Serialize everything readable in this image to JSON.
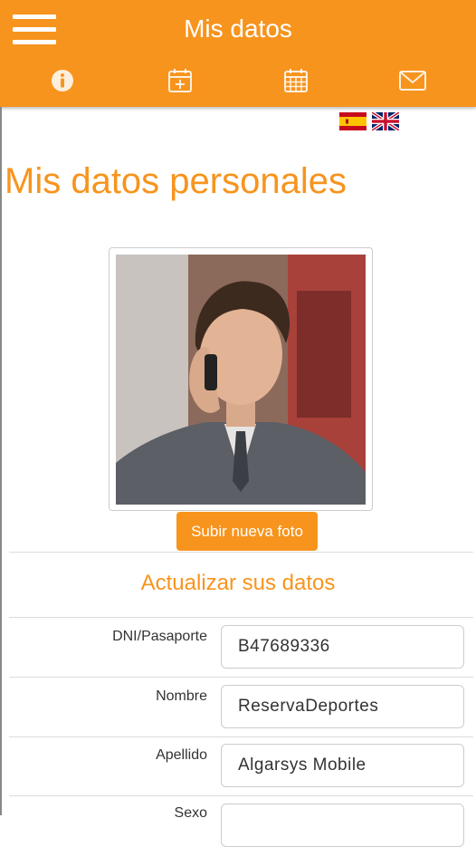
{
  "header": {
    "title": "Mis datos",
    "tabs": [
      {
        "icon": "info-icon"
      },
      {
        "icon": "calendar-add-icon"
      },
      {
        "icon": "calendar-icon"
      },
      {
        "icon": "mail-icon"
      }
    ],
    "color": "#f7941d"
  },
  "languages": [
    {
      "icon": "spain-flag-icon"
    },
    {
      "icon": "uk-flag-icon"
    }
  ],
  "page": {
    "title": "Mis datos personales",
    "upload_label": "Subir nueva foto",
    "section_title": "Actualizar sus datos"
  },
  "form": {
    "fields": [
      {
        "label": "DNI/Pasaporte",
        "value": "B47689336"
      },
      {
        "label": "Nombre",
        "value": "ReservaDeportes"
      },
      {
        "label": "Apellido",
        "value": "Algarsys Mobile"
      },
      {
        "label": "Sexo",
        "value": ""
      }
    ]
  }
}
